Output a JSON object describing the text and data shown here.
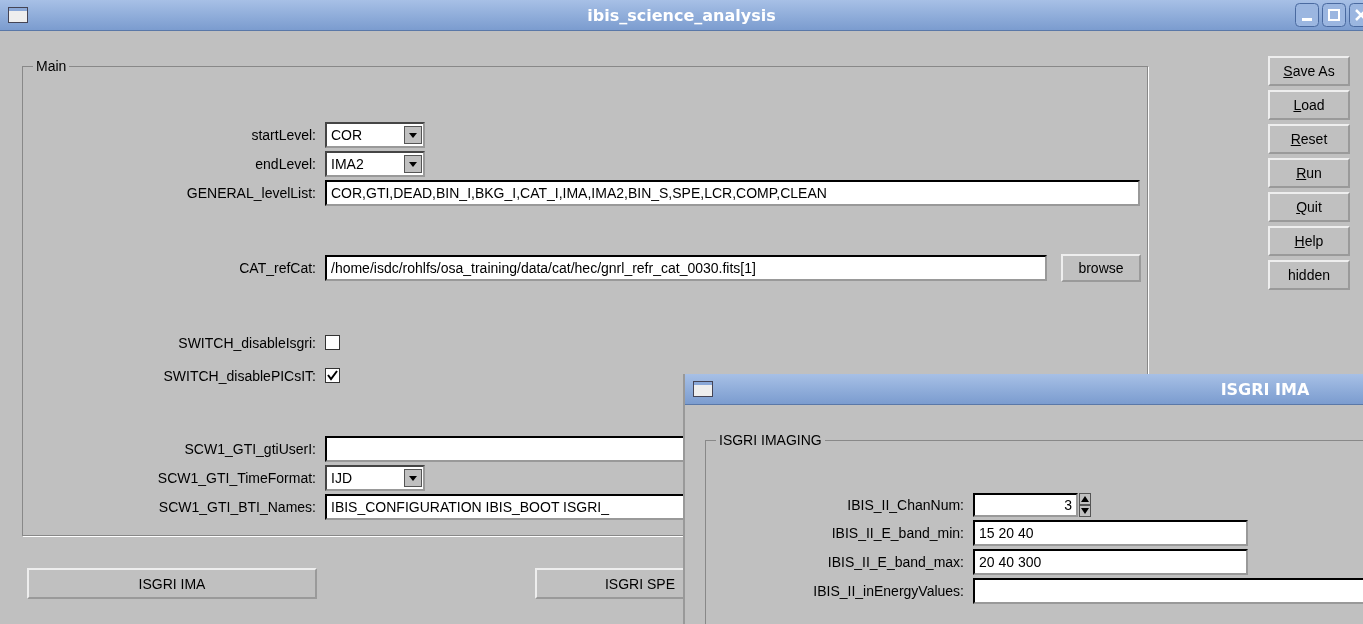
{
  "window": {
    "title": "ibis_science_analysis"
  },
  "main": {
    "legend": "Main",
    "groups": [
      [
        {
          "kind": "combo",
          "label": "startLevel:",
          "value": "COR"
        },
        {
          "kind": "combo",
          "label": "endLevel:",
          "value": "IMA2"
        },
        {
          "kind": "text",
          "label": "GENERAL_levelList:",
          "value": "COR,GTI,DEAD,BIN_I,BKG_I,CAT_I,IMA,IMA2,BIN_S,SPE,LCR,COMP,CLEAN"
        }
      ],
      [
        {
          "kind": "file",
          "label": "CAT_refCat:",
          "value": "/home/isdc/rohlfs/osa_training/data/cat/hec/gnrl_refr_cat_0030.fits[1]",
          "button": "browse"
        }
      ],
      [
        {
          "kind": "checkbox",
          "label": "SWITCH_disableIsgri:",
          "checked": false
        },
        {
          "kind": "checkbox",
          "label": "SWITCH_disablePICsIT:",
          "checked": true
        }
      ],
      [
        {
          "kind": "text",
          "label": "SCW1_GTI_gtiUserI:"
        },
        {
          "kind": "combo",
          "label": "SCW1_GTI_TimeFormat:",
          "value": "IJD"
        },
        {
          "kind": "text",
          "label": "SCW1_GTI_BTI_Names:",
          "value": "IBIS_CONFIGURATION IBIS_BOOT ISGRI_"
        }
      ]
    ]
  },
  "side_buttons": [
    {
      "label": "Save As",
      "underline_first": true
    },
    {
      "label": "Load",
      "underline_first": true
    },
    {
      "label": "Reset",
      "underline_first": true
    },
    {
      "label": "Run",
      "underline_first": true
    },
    {
      "label": "Quit",
      "underline_first": true
    },
    {
      "label": "Help",
      "underline_first": true
    },
    {
      "label": "hidden",
      "underline_first": false
    }
  ],
  "bottom_buttons": [
    {
      "label": "ISGRI IMA"
    },
    {
      "label": "ISGRI SPE"
    }
  ],
  "dialog": {
    "title": "ISGRI IMA",
    "legend": "ISGRI IMAGING",
    "rows": [
      {
        "kind": "spin",
        "label": "IBIS_II_ChanNum:",
        "value": "3"
      },
      {
        "kind": "text",
        "label": "IBIS_II_E_band_min:",
        "value": "15 20 40"
      },
      {
        "kind": "text",
        "label": "IBIS_II_E_band_max:",
        "value": "20 40 300"
      },
      {
        "kind": "wide",
        "label": "IBIS_II_inEnergyValues:"
      }
    ]
  }
}
